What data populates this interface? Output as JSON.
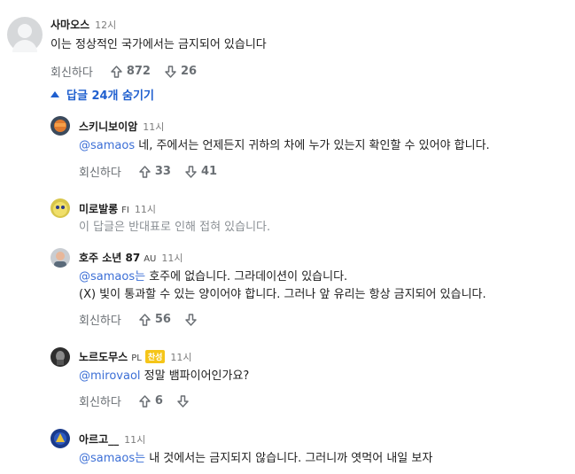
{
  "root": {
    "username": "사마오스",
    "time": "12시",
    "text": "이는 정상적인 국가에서는 금지되어 있습니다",
    "reply_label": "회신하다",
    "upvotes": "872",
    "downvotes": "26"
  },
  "replies_toggle": "답글 24개 숨기기",
  "replies": [
    {
      "username": "스키니보이암",
      "time": "11시",
      "mention": "@samaos",
      "text": " 네, 주에서는 언제든지 귀하의 차에 누가 있는지 확인할 수 있어야 합니다.",
      "reply_label": "회신하다",
      "upvotes": "33",
      "downvotes": "41"
    },
    {
      "username": "미로발롱",
      "flair": "FI",
      "time": "11시",
      "collapsed_text": "이 답글은 반대표로 인해 접혀 있습니다."
    },
    {
      "username": "호주 소년 87",
      "flair": "AU",
      "time": "11시",
      "mention": "@samaos는",
      "text": " 호주에 없습니다. 그라데이션이 있습니다.",
      "text_line2": "(X) 빛이 통과할 수 있는 양이어야 합니다. 그러나 앞 유리는 항상 금지되어 있습니다.",
      "reply_label": "회신하다",
      "upvotes": "56"
    },
    {
      "username": "노르도무스",
      "flair": "PL",
      "badge": "찬성",
      "time": "11시",
      "mention": "@mirovaol",
      "text": " 정말 뱀파이어인가요?",
      "reply_label": "회신하다",
      "upvotes": "6"
    },
    {
      "username": "아르고__",
      "time": "11시",
      "mention": "@samaos는",
      "text": " 내 것에서는 금지되지 않습니다. 그러니까 엿먹어 내일 보자"
    }
  ],
  "colors": {
    "accent": "#1f5fcf",
    "mention": "#3c6fd6",
    "muted": "#6a6f74"
  },
  "icons": [
    "upvote-arrow-icon",
    "downvote-arrow-icon",
    "caret-up-icon"
  ]
}
